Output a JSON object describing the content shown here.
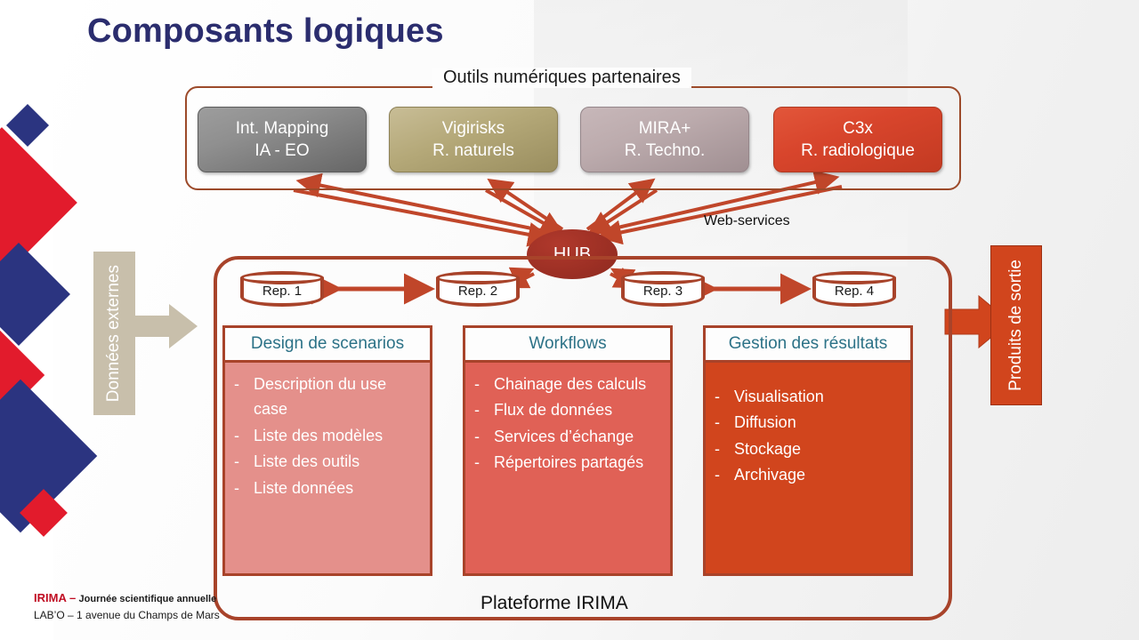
{
  "slide": {
    "title": "Composants logiques"
  },
  "partners": {
    "legend": "Outils numériques partenaires",
    "tools": [
      {
        "name": "Int. Mapping",
        "subtitle": "IA - EO",
        "color": "#8f8f8f"
      },
      {
        "name": "Vigirisks",
        "subtitle": "R. naturels",
        "color": "#b4a878"
      },
      {
        "name": "MIRA+",
        "subtitle": "R. Techno.",
        "color": "#bcabad"
      },
      {
        "name": "C3x",
        "subtitle": "R. radiologique",
        "color": "#d8452c"
      }
    ]
  },
  "hub": {
    "label": "HUB",
    "connection_label": "Web-services",
    "color": "#9c2f24"
  },
  "platform": {
    "label": "Plateforme IRIMA",
    "border_color": "#a8432a",
    "repositories": [
      {
        "label": "Rep. 1"
      },
      {
        "label": "Rep. 2"
      },
      {
        "label": "Rep. 3"
      },
      {
        "label": "Rep. 4"
      }
    ],
    "panels": [
      {
        "title": "Design de scenarios",
        "color": "#e4908b",
        "items": [
          "Description du use case",
          "Liste des modèles",
          "Liste des outils",
          "Liste données"
        ]
      },
      {
        "title": "Workflows",
        "color": "#e06156",
        "items": [
          "Chainage des calculs",
          "Flux de données",
          "Services d’échange",
          "Répertoires partagés"
        ]
      },
      {
        "title": "Gestion des résultats",
        "color": "#d1451d",
        "items": [
          "Visualisation",
          "Diffusion",
          "Stockage",
          "Archivage"
        ]
      }
    ]
  },
  "io": {
    "input_label": "Données externes",
    "input_color": "#c8bfab",
    "output_label": "Produits de sortie",
    "output_color": "#d1451d"
  },
  "footer": {
    "brand": "IRIMA –",
    "event": "Journée scientifique annuelle",
    "address": "LAB’O – 1 avenue du Champs de Mars"
  },
  "decor": {
    "navy": "#2b3480",
    "red": "#e21b2c"
  }
}
